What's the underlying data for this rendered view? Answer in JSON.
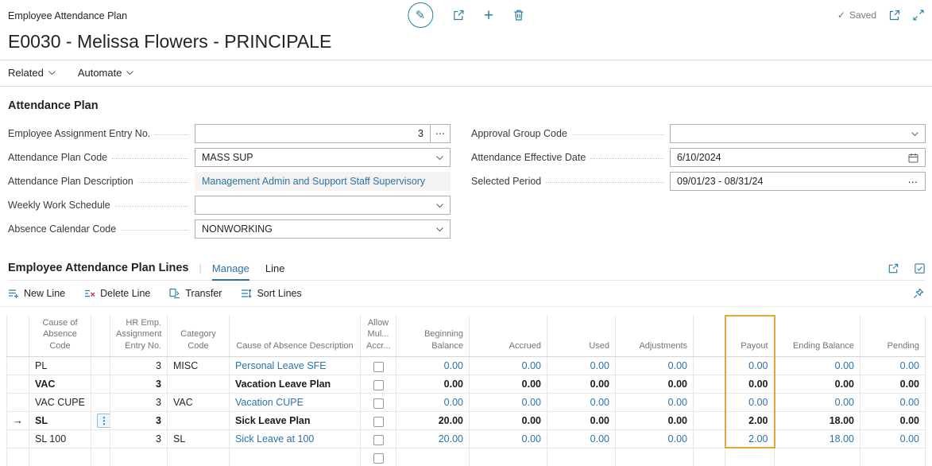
{
  "header": {
    "breadcrumb": "Employee Attendance Plan",
    "title": "E0030 - Melissa Flowers - PRINCIPALE",
    "saved_label": "Saved"
  },
  "menu": {
    "related": "Related",
    "automate": "Automate"
  },
  "form": {
    "section_title": "Attendance Plan",
    "fields": {
      "employee_assignment_entry_no": {
        "label": "Employee Assignment Entry No.",
        "value": "3"
      },
      "attendance_plan_code": {
        "label": "Attendance Plan Code",
        "value": "MASS SUP"
      },
      "attendance_plan_description": {
        "label": "Attendance Plan Description",
        "value": "Management Admin and Support Staff Supervisory"
      },
      "weekly_work_schedule": {
        "label": "Weekly Work Schedule",
        "value": ""
      },
      "absence_calendar_code": {
        "label": "Absence Calendar Code",
        "value": "NONWORKING"
      },
      "approval_group_code": {
        "label": "Approval Group Code",
        "value": ""
      },
      "attendance_effective_date": {
        "label": "Attendance Effective Date",
        "value": "6/10/2024"
      },
      "selected_period": {
        "label": "Selected Period",
        "value": "09/01/23 - 08/31/24"
      }
    }
  },
  "lines": {
    "section_title": "Employee Attendance Plan Lines",
    "tabs": {
      "manage": "Manage",
      "line": "Line"
    },
    "toolbar": {
      "new_line": "New Line",
      "delete_line": "Delete Line",
      "transfer": "Transfer",
      "sort_lines": "Sort Lines"
    },
    "table": {
      "headers": {
        "cause_code": "Cause of\nAbsence Code",
        "entry_no": "HR Emp.\nAssignment\nEntry No.",
        "category_code": "Category Code",
        "description": "Cause of Absence Description",
        "allow_multiple": "Allow\nMul...\nAccr...",
        "beginning_balance": "Beginning Balance",
        "accrued": "Accrued",
        "used": "Used",
        "adjustments": "Adjustments",
        "payout": "Payout",
        "ending_balance": "Ending Balance",
        "pending": "Pending"
      },
      "rows": [
        {
          "cause_code": "PL",
          "entry_no": "3",
          "category_code": "MISC",
          "description": "Personal Leave SFE",
          "beginning_balance": "0.00",
          "accrued": "0.00",
          "used": "0.00",
          "adjustments": "0.00",
          "payout": "0.00",
          "ending_balance": "0.00",
          "pending": "0.00"
        },
        {
          "cause_code": "VAC",
          "entry_no": "3",
          "category_code": "",
          "description": "Vacation Leave Plan",
          "beginning_balance": "0.00",
          "accrued": "0.00",
          "used": "0.00",
          "adjustments": "0.00",
          "payout": "0.00",
          "ending_balance": "0.00",
          "pending": "0.00"
        },
        {
          "cause_code": "VAC CUPE",
          "entry_no": "3",
          "category_code": "VAC",
          "description": "Vacation CUPE",
          "beginning_balance": "0.00",
          "accrued": "0.00",
          "used": "0.00",
          "adjustments": "0.00",
          "payout": "0.00",
          "ending_balance": "0.00",
          "pending": "0.00"
        },
        {
          "cause_code": "SL",
          "entry_no": "3",
          "category_code": "",
          "description": "Sick Leave Plan",
          "beginning_balance": "20.00",
          "accrued": "0.00",
          "used": "0.00",
          "adjustments": "0.00",
          "payout": "2.00",
          "ending_balance": "18.00",
          "pending": "0.00"
        },
        {
          "cause_code": "SL 100",
          "entry_no": "3",
          "category_code": "SL",
          "description": "Sick Leave at 100",
          "beginning_balance": "20.00",
          "accrued": "0.00",
          "used": "0.00",
          "adjustments": "0.00",
          "payout": "2.00",
          "ending_balance": "18.00",
          "pending": "0.00"
        }
      ]
    }
  },
  "colors": {
    "link_blue": "#2a74a8",
    "icon_blue": "#2b7fa3",
    "payout_highlight_orange": "#e8a33d"
  }
}
